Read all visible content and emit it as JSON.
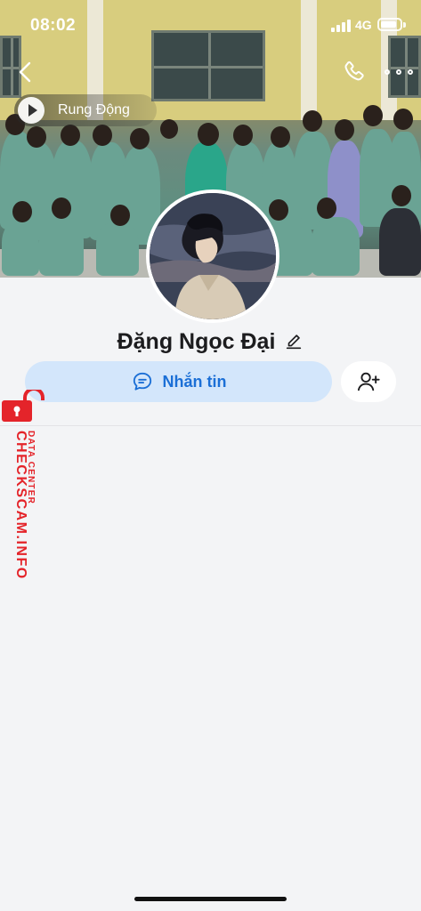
{
  "status_bar": {
    "time": "08:02",
    "network": "4G",
    "battery_level": 0.85
  },
  "top_bar": {
    "back_icon": "chevron-left-icon",
    "call_icon": "phone-icon",
    "more_icon": "more-horizontal-icon"
  },
  "music": {
    "icon": "play-icon",
    "title": "Rung Động"
  },
  "profile": {
    "name": "Đặng Ngọc Đại",
    "edit_icon": "pencil-icon"
  },
  "actions": {
    "message_label": "Nhắn tin",
    "message_icon": "chat-bubble-icon",
    "add_friend_icon": "add-user-icon"
  },
  "watermark": {
    "line1": "CHECKSCAM.INFO",
    "line2": "DATA CENTER",
    "color": "#e4242a"
  },
  "colors": {
    "accent": "#1b6fd6",
    "button_bg": "#d3e6fb",
    "background": "#f3f4f6"
  }
}
